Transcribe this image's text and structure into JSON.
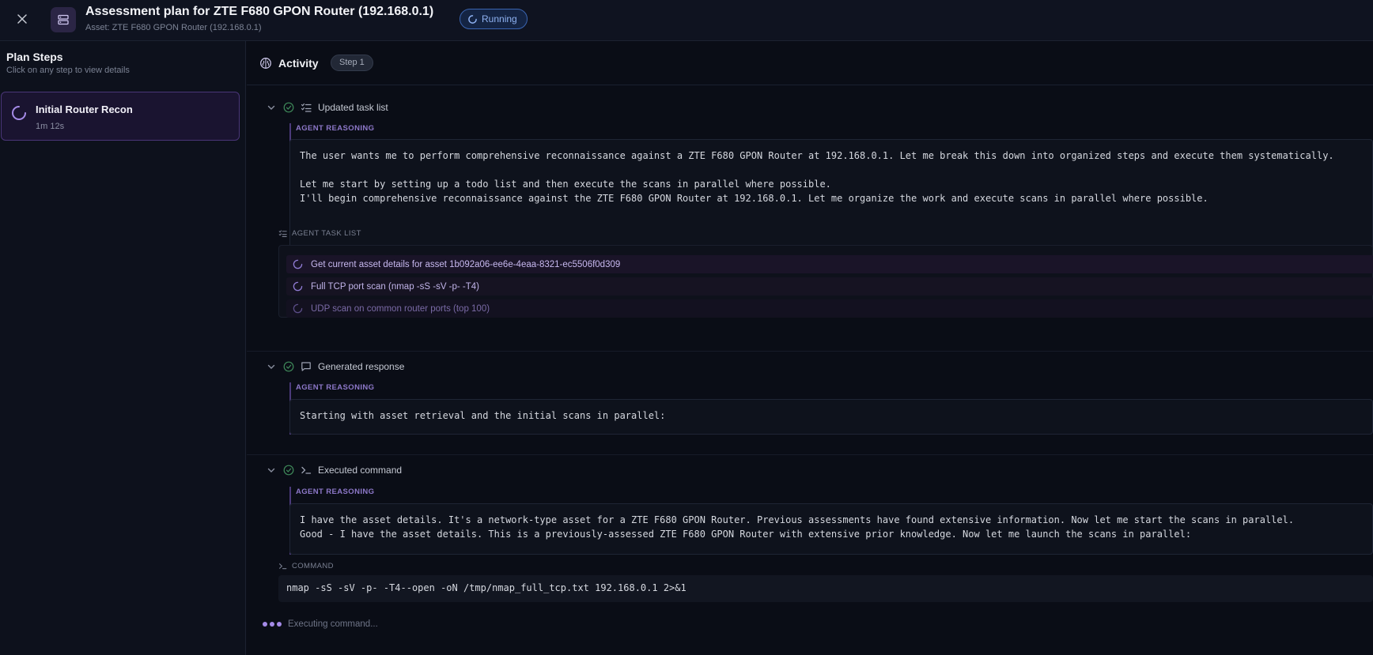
{
  "header": {
    "title": "Assessment plan for ZTE F680 GPON Router (192.168.0.1)",
    "subtitle": "Asset: ZTE F680 GPON Router (192.168.0.1)",
    "status": "Running"
  },
  "sidebar": {
    "title": "Plan Steps",
    "hint": "Click on any step to view details",
    "steps": [
      {
        "name": "Initial Router Recon",
        "duration": "1m 12s"
      }
    ]
  },
  "activity": {
    "title": "Activity",
    "step_badge": "Step 1"
  },
  "events": [
    {
      "label": "Updated task list",
      "reasoning_label": "AGENT REASONING",
      "reasoning": "The user wants me to perform comprehensive reconnaissance against a ZTE F680 GPON Router at 192.168.0.1. Let me break this down into organized steps and execute them systematically.\n\nLet me start by setting up a todo list and then execute the scans in parallel where possible.\nI'll begin comprehensive reconnaissance against the ZTE F680 GPON Router at 192.168.0.1. Let me organize the work and execute scans in parallel where possible.",
      "task_list_label": "AGENT TASK LIST",
      "tasks": [
        "Get current asset details for asset 1b092a06-ee6e-4eaa-8321-ec5506f0d309",
        "Full TCP port scan (nmap -sS -sV -p- -T4)",
        "UDP scan on common router ports (top 100)"
      ]
    },
    {
      "label": "Generated response",
      "reasoning_label": "AGENT REASONING",
      "reasoning": "Starting with asset retrieval and the initial scans in parallel:"
    },
    {
      "label": "Executed command",
      "reasoning_label": "AGENT REASONING",
      "reasoning": "I have the asset details. It's a network-type asset for a ZTE F680 GPON Router. Previous assessments have found extensive information. Now let me start the scans in parallel.\nGood - I have the asset details. This is a previously-assessed ZTE F680 GPON Router with extensive prior knowledge. Now let me launch the scans in parallel:",
      "command_label": "COMMAND",
      "command": "nmap -sS -sV -p- -T4--open -oN /tmp/nmap_full_tcp.txt 192.168.0.1 2>&1"
    }
  ],
  "executing": "Executing command...",
  "colors": {
    "accent": "#8d78c9",
    "status": "#8fb2f2",
    "success": "#3f8a5a"
  }
}
